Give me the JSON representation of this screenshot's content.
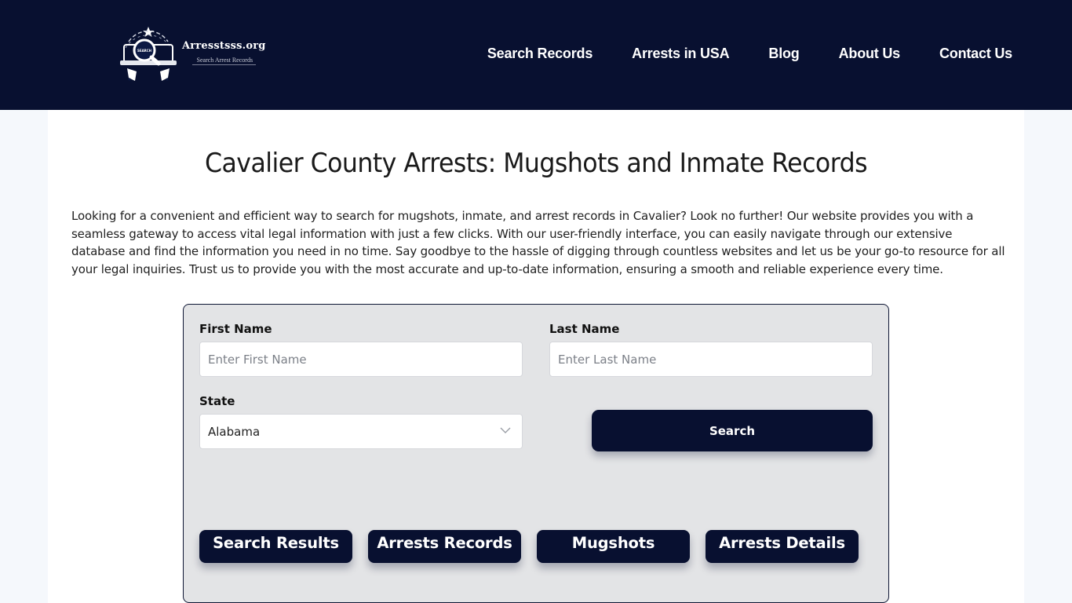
{
  "header": {
    "logo": {
      "name": "Arresstsss.org",
      "tagline": "Search Arrest Records",
      "badge_text": "SEARCH"
    },
    "nav": [
      {
        "label": "Search Records"
      },
      {
        "label": "Arrests in USA"
      },
      {
        "label": "Blog"
      },
      {
        "label": "About Us"
      },
      {
        "label": "Contact Us"
      }
    ]
  },
  "main": {
    "title": "Cavalier County Arrests: Mugshots and Inmate Records",
    "intro": "Looking for a convenient and efficient way to search for mugshots, inmate, and arrest records in Cavalier? Look no further! Our website provides you with a seamless gateway to access vital legal information with just a few clicks. With our user-friendly interface, you can easily navigate through our extensive database and find the information you need in no time. Say goodbye to the hassle of digging through countless websites and let us be your go-to resource for all your legal inquiries. Trust us to provide you with the most accurate and up-to-date information, ensuring a smooth and reliable experience every time."
  },
  "form": {
    "first_name": {
      "label": "First Name",
      "placeholder": "Enter First Name",
      "value": ""
    },
    "last_name": {
      "label": "Last Name",
      "placeholder": "Enter Last Name",
      "value": ""
    },
    "state": {
      "label": "State",
      "selected": "Alabama"
    },
    "search_label": "Search",
    "links": [
      {
        "label": "Search Results"
      },
      {
        "label": "Arrests Records"
      },
      {
        "label": "Mugshots"
      },
      {
        "label": "Arrests Details"
      }
    ]
  },
  "colors": {
    "brand_navy": "#081030",
    "page_bg": "#f5f8fc",
    "card_bg": "#e3e4e6"
  }
}
